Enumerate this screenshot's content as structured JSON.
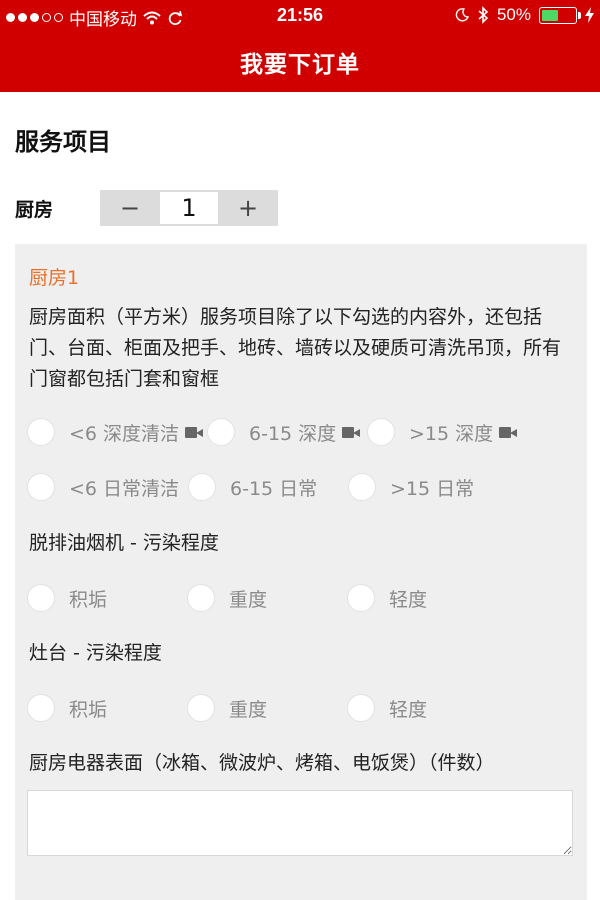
{
  "status_bar": {
    "carrier": "中国移动",
    "time": "21:56",
    "battery_percent": "50%",
    "battery_level": 0.5,
    "icons": [
      "signal-dots-icon",
      "wifi-icon",
      "sync-icon",
      "moon-icon",
      "bluetooth-icon",
      "battery-icon",
      "charging-bolt-icon"
    ],
    "battery_fill_color": "#4cd964"
  },
  "navbar": {
    "title": "我要下订单",
    "color": "#d10000"
  },
  "services": {
    "title": "服务项目",
    "kitchen_label": "厨房",
    "stepper": {
      "minus": "−",
      "value": "1",
      "plus": "+"
    }
  },
  "card": {
    "title": "厨房1",
    "title_color": "#e8702a",
    "description": "厨房面积（平方米）服务项目除了以下勾选的内容外，还包括门、台面、柜面及把手、地砖、墙砖以及硬质可清洗吊顶，所有门窗都包括门套和窗框",
    "area_deep": [
      "<6 深度清洁",
      "6-15 深度",
      ">15 深度"
    ],
    "area_daily": [
      "<6 日常清洁",
      "6-15 日常",
      ">15 日常"
    ],
    "hood_label": "脱排油烟机 - 污染程度",
    "hood_options": [
      "积垢",
      "重度",
      "轻度"
    ],
    "stove_label": "灶台 - 污染程度",
    "stove_options": [
      "积垢",
      "重度",
      "轻度"
    ],
    "appliance_label": "厨房电器表面（冰箱、微波炉、烤箱、电饭煲）（件数）",
    "appliance_value": ""
  }
}
